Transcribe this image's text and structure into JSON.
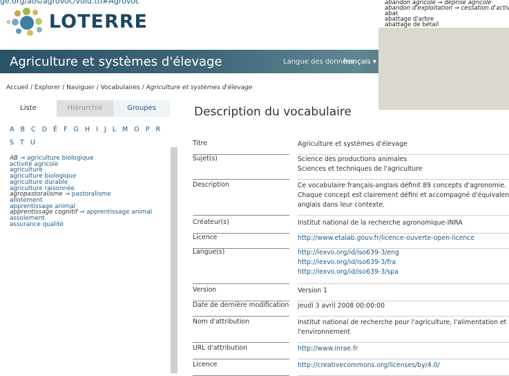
{
  "top_url": "ge.org/aos/agrovoc/void.ttl#Agrovoc",
  "logo": {
    "prefix": "o",
    "text": "LOTERRE"
  },
  "header": {
    "title": "Agriculture et systèmes d'élevage",
    "lang_label": "Langue des données",
    "lang_value": "français ▾"
  },
  "popup_terms": [
    {
      "text": "abandon agricole → déprise agricole",
      "italic": true
    },
    {
      "text": "abandon d'exploitation → cessation d'activ",
      "italic": true
    },
    {
      "text": "abat",
      "italic": false
    },
    {
      "text": "abattage d'arbre",
      "italic": false
    },
    {
      "text": "abattage de bétail",
      "italic": false
    }
  ],
  "breadcrumb": {
    "path": "Accueil / Explorer / Naviguer / Vocabulaires / ",
    "current": "Agriculture et systèmes d'élevage"
  },
  "tabs": [
    "Liste",
    "Hiérarchie",
    "Groupes"
  ],
  "alphabet": "A B C D É F G H I J L M O P R S T U",
  "terms": [
    {
      "alt": "AB",
      "pref": "agriculture biologique"
    },
    {
      "alt": "",
      "pref": "activité agricole"
    },
    {
      "alt": "",
      "pref": "agriculture"
    },
    {
      "alt": "",
      "pref": "agriculture biologique"
    },
    {
      "alt": "",
      "pref": "agriculture durable"
    },
    {
      "alt": "",
      "pref": "agriculture raisonnée"
    },
    {
      "alt": "agropastoralisme",
      "pref": "pastoralisme"
    },
    {
      "alt": "",
      "pref": "allotement"
    },
    {
      "alt": "",
      "pref": "apprentissage animal"
    },
    {
      "alt": "apprentissage cognitif",
      "pref": "apprentissage animal"
    },
    {
      "alt": "",
      "pref": "assolement"
    },
    {
      "alt": "",
      "pref": "assurance qualité"
    }
  ],
  "main": {
    "title": "Description du vocabulaire",
    "properties": [
      {
        "key": "Titre",
        "values": [
          "Agriculture et systèmes d'élevage"
        ],
        "link": false
      },
      {
        "key": "Sujet(s)",
        "values": [
          "Science des productions animales",
          "Sciences et techniques de l'agriculture"
        ],
        "link": false
      },
      {
        "key": "Description",
        "values": [
          "Ce vocabulaire français-anglais définit 89 concepts d'agronomie.",
          "Chaque concept est clairement défini et accompagné d'équivalents",
          "anglais dans leur contexte."
        ],
        "link": false
      },
      {
        "key": "Créateur(s)",
        "values": [
          "Institut national de la recherche agronomique-INRA"
        ],
        "link": false
      },
      {
        "key": "Licence",
        "values": [
          "http://www.etalab.gouv.fr/licence-ouverte-open-licence"
        ],
        "link": true
      },
      {
        "key": "Langue(s)",
        "values": [
          "http://lexvo.org/id/iso639-3/eng",
          "http://lexvo.org/id/iso639-3/fra",
          "http://lexvo.org/id/iso639-3/spa"
        ],
        "link": true
      },
      {
        "key": "Version",
        "values": [
          "Version 1"
        ],
        "link": false
      },
      {
        "key": "Date de dernière modification",
        "values": [
          "jeudi 3 avril 2008 00:00:00"
        ],
        "link": false
      },
      {
        "key": "Nom d'attribution",
        "values": [
          "Institut national de recherche pour l'agriculture, l'alimentation et",
          "l'environnement"
        ],
        "link": false
      },
      {
        "key": "URL d'attribution",
        "values": [
          "http://www.inrae.fr"
        ],
        "link": true
      },
      {
        "key": "Licence",
        "values": [
          "http://creativecommons.org/licenses/by/4.0/"
        ],
        "link": true
      }
    ]
  }
}
